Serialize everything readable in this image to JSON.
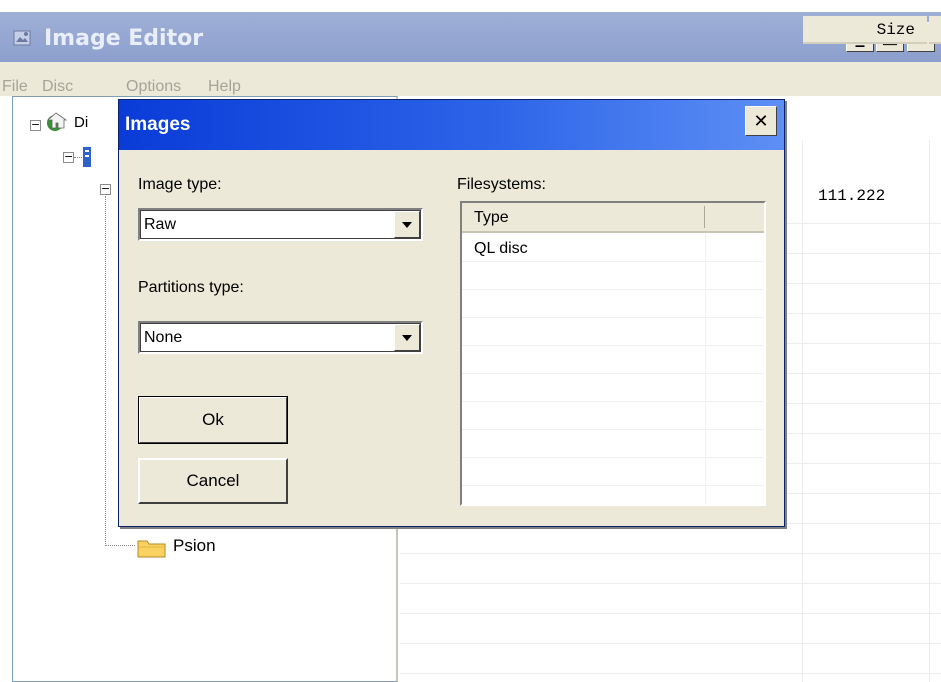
{
  "window": {
    "title": "Image Editor",
    "menu": [
      "File",
      "Disc",
      "Options",
      "Help"
    ],
    "minimize_label": "_",
    "maximize_label": "□",
    "close_label": "✕"
  },
  "tree": {
    "root_label": "Di",
    "folder_label": "Psion"
  },
  "list": {
    "size_header": "Size",
    "size_value": "111.222"
  },
  "dialog": {
    "title": "Images",
    "close_label": "✕",
    "image_type_label": "Image type:",
    "image_type_value": "Raw",
    "partitions_type_label": "Partitions type:",
    "partitions_type_value": "None",
    "filesystems_label": "Filesystems:",
    "filesystems_column_header": "Type",
    "filesystems_rows": [
      "QL disc"
    ],
    "ok_label": "Ok",
    "cancel_label": "Cancel"
  },
  "colors": {
    "dialog_title_start": "#0a3bd8",
    "dialog_title_end": "#5e8ff5",
    "main_title_bar": "#9fb0d6",
    "face": "#ece9d8"
  },
  "icons": {
    "app": "image-editor-app-icon",
    "root": "disc-home-icon",
    "folder": "folder-icon",
    "dropdown": "chevron-down-icon"
  }
}
